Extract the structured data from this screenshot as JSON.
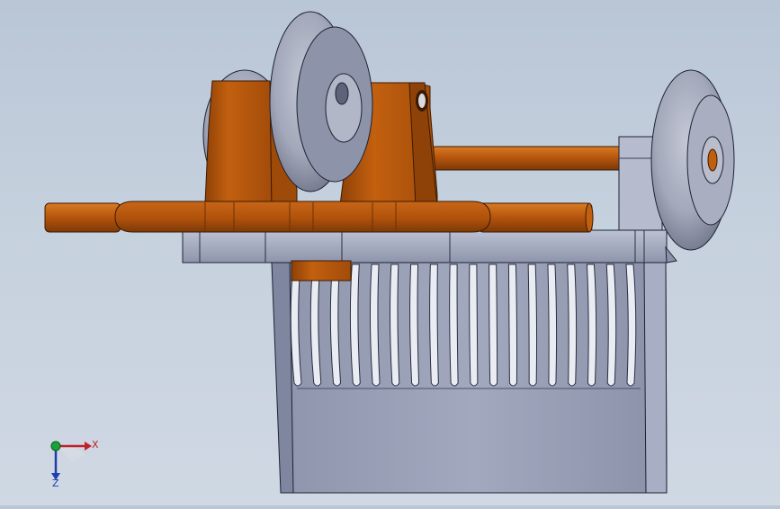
{
  "viewport": {
    "background_top": "#b9c6d6",
    "background_bottom": "#cfd8e3",
    "model": {
      "body_color": "#9aa1b8",
      "body_dark": "#6f7690",
      "frame_color": "#a7adc2",
      "bracket_color": "#b4540c",
      "bracket_dark": "#7a3a08",
      "axle_color": "#c0600e",
      "wheel_color": "#9aa0b4",
      "slot_count": 18
    },
    "triad": {
      "x_label": "X",
      "z_label": "Z",
      "x_color": "#c0212a",
      "y_color": "#1aa33a",
      "z_color": "#1f3fb0"
    }
  }
}
